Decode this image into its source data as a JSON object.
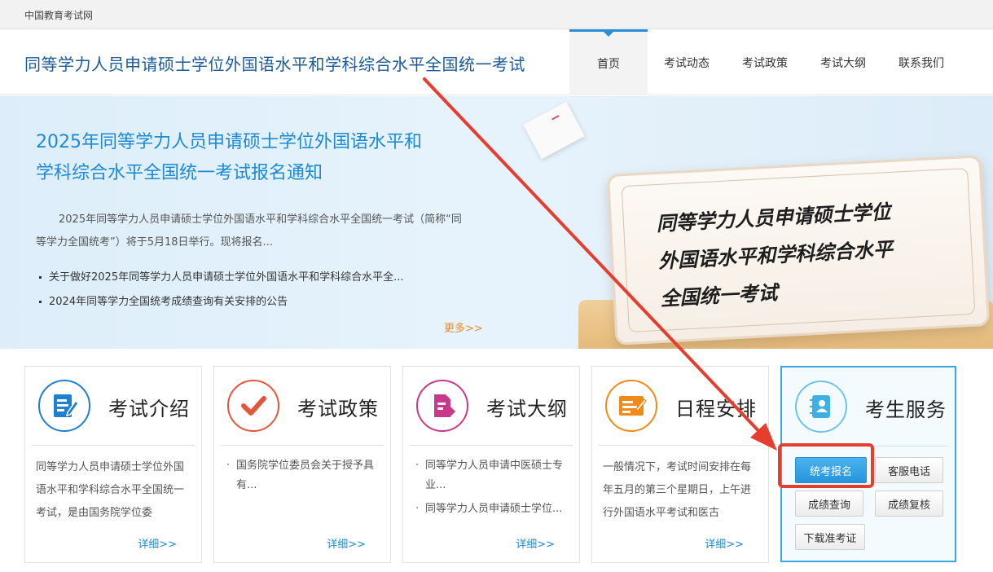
{
  "topbar": {
    "site_name": "中国教育考试网"
  },
  "header": {
    "title": "同等学力人员申请硕士学位外国语水平和学科综合水平全国统一考试",
    "nav": [
      "首页",
      "考试动态",
      "考试政策",
      "考试大纲",
      "联系我们"
    ],
    "active_nav": "首页"
  },
  "banner": {
    "title_line1": "2025年同等学力人员申请硕士学位外国语水平和",
    "title_line2": "学科综合水平全国统一考试报名通知",
    "description": "2025年同等学力人员申请硕士学位外国语水平和学科综合水平全国统一考试（简称“同等学力全国统考”）将于5月18日举行。现将报名...",
    "news": [
      "关于做好2025年同等学力人员申请硕士学位外国语水平和学科综合水平全...",
      "2024年同等学力全国统考成绩查询有关安排的公告"
    ],
    "more": "更多>>",
    "board_text": [
      "同等学力人员申请硕士学位",
      "外国语水平和学科综合水平",
      "全国统一考试"
    ]
  },
  "cards": [
    {
      "title": "考试介绍",
      "text": "同等学力人员申请硕士学位外国语水平和学科综合水平全国统一考试，是由国务院学位委",
      "detail": "详细>>",
      "icon": "document-edit-icon",
      "color": "#1f7fd0"
    },
    {
      "title": "考试政策",
      "items": [
        "国务院学位委员会关于授予具有..."
      ],
      "detail": "详细>>",
      "icon": "checkmark-icon",
      "color": "#e5553a"
    },
    {
      "title": "考试大纲",
      "items": [
        "同等学力人员申请中医硕士专业...",
        "同等学力人员申请硕士学位..."
      ],
      "detail": "详细>>",
      "icon": "file-export-icon",
      "color": "#c9398a"
    },
    {
      "title": "日程安排",
      "text": "一般情况下，考试时间安排在每年五月的第三个星期日，上午进行外国语水平考试和医古",
      "detail": "详细>>",
      "icon": "schedule-board-icon",
      "color": "#f08a1a"
    }
  ],
  "service": {
    "title": "考生服务",
    "icon": "contact-book-icon",
    "buttons": {
      "register": "统考报名",
      "hotline": "客服电话",
      "score_query": "成绩查询",
      "score_review": "成绩复核",
      "admit_card": "下载准考证"
    }
  },
  "colors": {
    "accent": "#1d8ad8",
    "annotation": "#e53d2e",
    "more": "#f08a1a"
  }
}
